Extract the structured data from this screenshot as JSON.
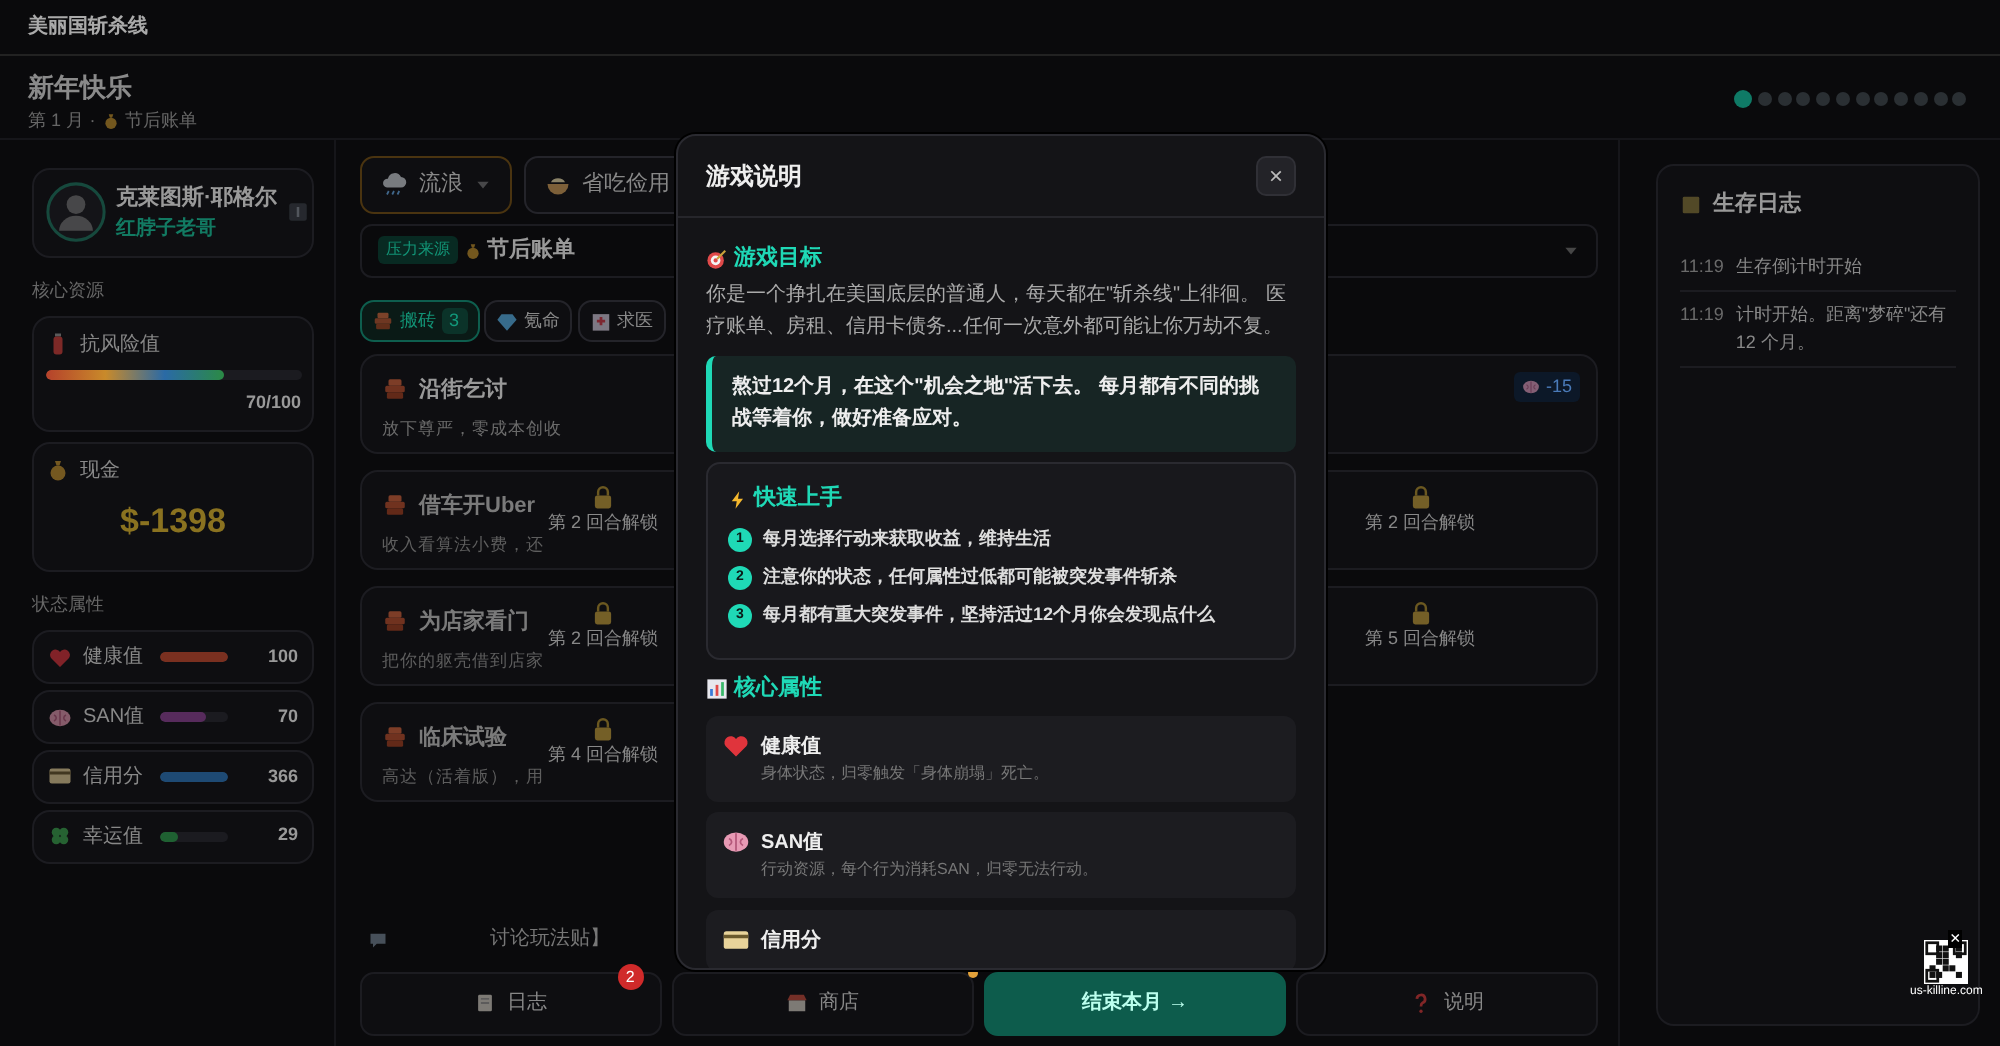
{
  "app_title": "美丽国斩杀线",
  "header": {
    "title": "新年快乐",
    "month": "第 1 月",
    "separator": "·",
    "event": "节后账单",
    "progress": [
      {
        "selected": true
      },
      {
        "selected": false
      },
      {
        "selected": false
      },
      {
        "selected": false
      },
      {
        "selected": false
      },
      {
        "selected": false
      },
      {
        "selected": false
      },
      {
        "selected": false
      },
      {
        "selected": false
      },
      {
        "selected": false
      },
      {
        "selected": false
      },
      {
        "selected": false
      }
    ]
  },
  "player": {
    "name": "克莱图斯·耶格尔",
    "role": "红脖子老哥"
  },
  "resources": {
    "heading": "核心资源",
    "risk": {
      "label": "抗风险值",
      "level": 0.7,
      "reading": "70/100"
    },
    "cash": {
      "label": "现金",
      "value": "$-1398"
    }
  },
  "status": {
    "heading": "状态属性",
    "stats": [
      {
        "name": "健康值",
        "level": 1,
        "reading": "100",
        "color": "#7a3020"
      },
      {
        "name": "SAN值",
        "level": 0.7,
        "reading": "70",
        "color": "#572b5c"
      },
      {
        "name": "信用分",
        "level": 1,
        "reading": "366",
        "color": "#1e4a74"
      },
      {
        "name": "幸运值",
        "level": 0.29,
        "reading": "29",
        "color": "#1f6132"
      }
    ]
  },
  "choices": [
    {
      "label": "流浪",
      "selected": true
    },
    {
      "label": "省吃俭用",
      "selected": false
    }
  ],
  "event_bar": {
    "tag": "压力来源",
    "label": "节后账单"
  },
  "tabs": [
    {
      "label": "搬砖",
      "count": "3",
      "selected": true
    },
    {
      "label": "氪命",
      "selected": false
    },
    {
      "label": "求医",
      "selected": false
    }
  ],
  "actions": [
    {
      "kind": "open",
      "title": "沿街乞讨",
      "desc": "放下尊严，零成本创收",
      "cost": "-15"
    },
    {
      "kind": "locked",
      "title": "借车开Uber",
      "desc": "收入看算法小费，还",
      "unlock": "第 2 回合解锁"
    },
    {
      "kind": "locked",
      "unlock": "第 2 回合解锁"
    },
    {
      "kind": "locked",
      "title": "为店家看门",
      "desc": "把你的躯壳借到店家",
      "unlock": "第 2 回合解锁"
    },
    {
      "kind": "locked",
      "unlock": "第 5 回合解锁"
    },
    {
      "kind": "locked",
      "title": "临床试验",
      "desc": "高达（活着版），用",
      "unlock": "第 4 回合解锁"
    }
  ],
  "notice": "讨论玩法贴】",
  "bottom_bar": [
    {
      "kind": "log",
      "label": "日志",
      "badge": "2"
    },
    {
      "kind": "shop",
      "label": "商店",
      "dot": true
    },
    {
      "kind": "primary",
      "label": "结束本月 →"
    },
    {
      "kind": "help",
      "label": "说明"
    }
  ],
  "log": {
    "title": "生存日志",
    "entries": [
      {
        "time": "11:19",
        "text": "生存倒计时开始"
      },
      {
        "time": "11:19",
        "text": "计时开始。距离\"梦碎\"还有 12 个月。"
      }
    ]
  },
  "qr": {
    "caption": "us-killine.com",
    "close": "×"
  },
  "modal": {
    "title": "游戏说明",
    "close": "×",
    "goal": {
      "heading": "游戏目标",
      "text": "你是一个挣扎在美国底层的普通人，每天都在\"斩杀线\"上徘徊。 医疗账单、房租、信用卡债务...任何一次意外都可能让你万劫不复。",
      "callout": "熬过12个月，在这个\"机会之地\"活下去。 每月都有不同的挑战等着你，做好准备应对。"
    },
    "quickstart": {
      "heading": "快速上手",
      "steps": [
        {
          "number": "1",
          "text": "每月选择行动来获取收益，维持生活"
        },
        {
          "number": "2",
          "text": "注意你的状态，任何属性过低都可能被突发事件斩杀"
        },
        {
          "number": "3",
          "text": "每月都有重大突发事件，坚持活过12个月你会发现点什么"
        }
      ]
    },
    "attributes": {
      "heading": "核心属性",
      "items": [
        {
          "name": "健康值",
          "desc": "身体状态，归零触发「身体崩塌」死亡。"
        },
        {
          "name": "SAN值",
          "desc": "行动资源，每个行为消耗SAN，归零无法行动。"
        },
        {
          "name": "信用分"
        }
      ]
    }
  }
}
